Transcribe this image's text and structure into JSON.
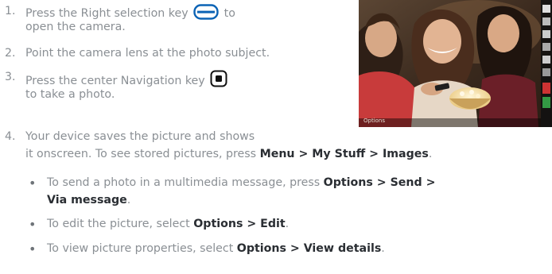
{
  "steps": [
    {
      "num": "1.",
      "line1_before": "Press the Right selection key",
      "line1_after": "to",
      "line2": "open the camera.",
      "key_icon": "right-selection-key-icon"
    },
    {
      "num": "2.",
      "line1": "Point the camera lens at the photo subject."
    },
    {
      "num": "3.",
      "line1": "Press the center Navigation key",
      "line2": "to take a photo.",
      "key_icon": "center-navigation-key-icon"
    },
    {
      "num": "4.",
      "line1": "Your device saves the picture and shows",
      "line2_before": "it onscreen. To see stored pictures, press",
      "line2_bold": "Menu > My Stuff > Images",
      "line2_after": "."
    }
  ],
  "bullets": [
    {
      "line1_before": "To send a photo in a multimedia message, press",
      "line1_bold": "Options > Send >",
      "line2_bold": "Via message",
      "line2_after": "."
    },
    {
      "before": "To edit the picture, select",
      "bold": "Options > Edit",
      "after": "."
    },
    {
      "before": "To view picture properties, select",
      "bold": "Options > View details",
      "after": "."
    }
  ],
  "photo": {
    "softkey_left": "Options"
  },
  "colors": {
    "body_text": "#8a8f94",
    "bold_text": "#2a2e33",
    "key_border": "#0b63b5"
  }
}
